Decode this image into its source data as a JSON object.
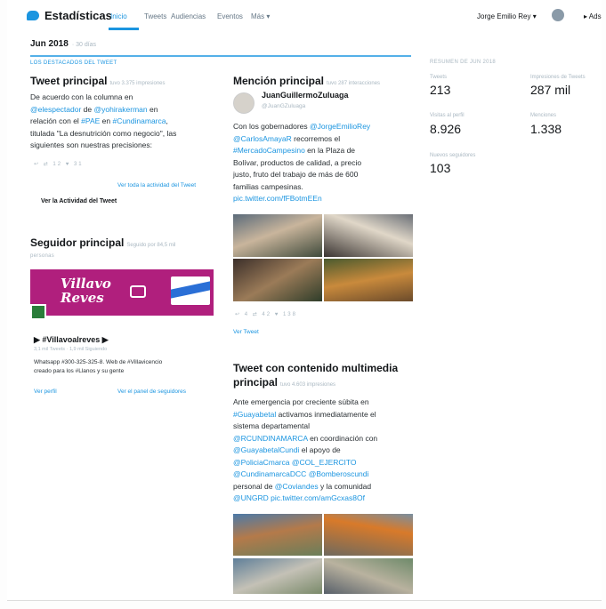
{
  "nav": {
    "title": "Estadísticas",
    "tabs": [
      "Inicio",
      "Tweets",
      "Audiencias",
      "Eventos",
      "Más ▾"
    ],
    "user_menu": "Jorge Emilio Rey ▾",
    "lang": "▸ Ads"
  },
  "period": {
    "label": "Jun 2018",
    "sub": "· 30 días"
  },
  "section_label": "LOS DESTACADOS DEL TWEET",
  "top_tweet": {
    "title": "Tweet principal",
    "meta": "tuvo 3.375 impresiones",
    "text": [
      [
        {
          "t": "De acuerdo con la columna en"
        }
      ],
      [
        {
          "t": "@elespectador",
          "c": "blue"
        },
        {
          "t": " de "
        },
        {
          "t": "@yohirakerman",
          "c": "blue"
        },
        {
          "t": " en"
        }
      ],
      [
        {
          "t": "relación con el "
        },
        {
          "t": "#PAE",
          "c": "blue"
        },
        {
          "t": " en "
        },
        {
          "t": "#Cundinamarca",
          "c": "blue"
        },
        {
          "t": ","
        }
      ],
      [
        {
          "t": "titulada \"La desnutrición como negocio\", las"
        }
      ],
      [
        {
          "t": "siguientes son nuestras precisiones:"
        }
      ]
    ],
    "actions": "↩ ⇄ 12 ♥ 31",
    "view_all": "Ver toda la actividad del Tweet",
    "view_activity": "Ver la Actividad del Tweet"
  },
  "top_follower": {
    "title": "Seguidor principal",
    "meta": "Seguido por 84,5 mil",
    "sub": "personas",
    "banner_text": "Villavo\nReves",
    "name": "▶ #Villavoalreves ▶",
    "stats": "3,1 mil Tweets · 1,9 mil Siguiendo",
    "bio_1": "Whatsapp #300-325-325-8. Web de #Villavicencio",
    "bio_2": "creado para los #Llanos y su gente",
    "view_profile": "Ver perfil",
    "view_panel": "Ver el panel de seguidores"
  },
  "top_mention": {
    "title": "Mención principal",
    "meta": "tuvo 287 interacciones",
    "author": "JuanGuillermoZuluaga",
    "handle": "@JuanGZuluaga",
    "text": [
      [
        {
          "t": "Con los gobernadores "
        },
        {
          "t": "@JorgeEmilioRey",
          "c": "blue"
        }
      ],
      [
        {
          "t": "@CarlosAmayaR",
          "c": "blue"
        },
        {
          "t": " recorremos el"
        }
      ],
      [
        {
          "t": "#MercadoCampesino",
          "c": "blue"
        },
        {
          "t": " en la Plaza de"
        }
      ],
      [
        {
          "t": "Bolívar, productos de calidad, a precio"
        }
      ],
      [
        {
          "t": "justo, fruto del trabajo de más de 600"
        }
      ],
      [
        {
          "t": "familias campesinas."
        }
      ],
      [
        {
          "t": "pic.twitter.com/fFBotmEEn",
          "c": "blue"
        }
      ]
    ],
    "actions": "↩ 4 ⇄ 42 ♥ 138",
    "view_tweet": "Ver Tweet"
  },
  "top_media": {
    "title_1": "Tweet con contenido multimedia",
    "title_2": "principal",
    "meta": "tuvo 4.603 impresiones",
    "text": [
      [
        {
          "t": "Ante emergencia por creciente súbita en"
        }
      ],
      [
        {
          "t": "#Guayabetal",
          "c": "blue"
        },
        {
          "t": " activamos inmediatamente el"
        }
      ],
      [
        {
          "t": "sistema departamental"
        }
      ],
      [
        {
          "t": "@RCUNDINAMARCA",
          "c": "blue"
        },
        {
          "t": " en coordinación con"
        }
      ],
      [
        {
          "t": "@GuayabetalCundi",
          "c": "blue"
        },
        {
          "t": " el apoyo de"
        }
      ],
      [
        {
          "t": "@PoliciaCmarca",
          "c": "blue"
        },
        {
          "t": " "
        },
        {
          "t": "@COL_EJERCITO",
          "c": "blue"
        }
      ],
      [
        {
          "t": "@CundinamarcaDCC",
          "c": "blue"
        },
        {
          "t": " "
        },
        {
          "t": "@Bomberoscundi",
          "c": "blue"
        }
      ],
      [
        {
          "t": "personal de "
        },
        {
          "t": "@Coviandes",
          "c": "blue"
        },
        {
          "t": " y la comunidad"
        }
      ],
      [
        {
          "t": "@UNGRD",
          "c": "blue"
        },
        {
          "t": " pic.twitter.com/amGcxas8Of",
          "c": "blue"
        }
      ]
    ]
  },
  "summary": {
    "label": "RESUMEN DE JUN 2018",
    "stats": [
      {
        "label": "Tweets",
        "value": "213"
      },
      {
        "label": "Impresiones de Tweets",
        "value": "287 mil"
      },
      {
        "label": "Visitas al perfil",
        "value": "8.926"
      },
      {
        "label": "Menciones",
        "value": "1.338"
      },
      {
        "label": "Nuevos seguidores",
        "value": "103"
      }
    ]
  },
  "colors": {
    "accent": "#1b95e0",
    "banner": "#b01f7d"
  }
}
